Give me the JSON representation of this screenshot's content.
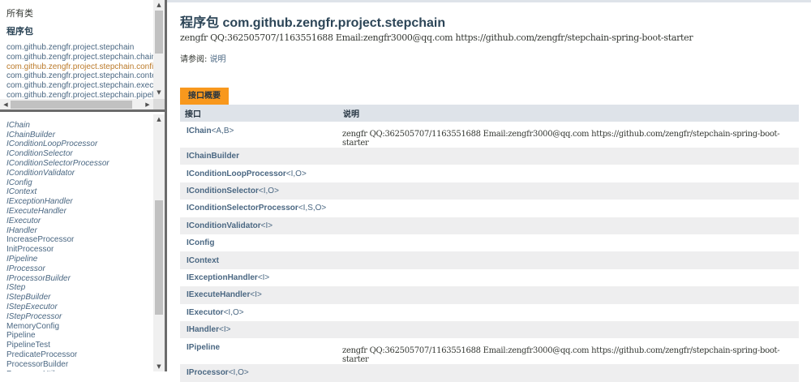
{
  "left": {
    "all_classes": "所有类",
    "packages_heading": "程序包",
    "packages": [
      {
        "label": "com.github.zengfr.project.stepchain",
        "active": false
      },
      {
        "label": "com.github.zengfr.project.stepchain.chain",
        "active": false
      },
      {
        "label": "com.github.zengfr.project.stepchain.config",
        "active": true
      },
      {
        "label": "com.github.zengfr.project.stepchain.context",
        "active": false
      },
      {
        "label": "com.github.zengfr.project.stepchain.executor",
        "active": false
      },
      {
        "label": "com.github.zengfr.project.stepchain.pipeline",
        "active": false
      }
    ],
    "classes": [
      {
        "label": "IChain",
        "interface": true
      },
      {
        "label": "IChainBuilder",
        "interface": true
      },
      {
        "label": "IConditionLoopProcessor",
        "interface": true
      },
      {
        "label": "IConditionSelector",
        "interface": true
      },
      {
        "label": "IConditionSelectorProcessor",
        "interface": true
      },
      {
        "label": "IConditionValidator",
        "interface": true
      },
      {
        "label": "IConfig",
        "interface": true
      },
      {
        "label": "IContext",
        "interface": true
      },
      {
        "label": "IExceptionHandler",
        "interface": true
      },
      {
        "label": "IExecuteHandler",
        "interface": true
      },
      {
        "label": "IExecutor",
        "interface": true
      },
      {
        "label": "IHandler",
        "interface": true
      },
      {
        "label": "IncreaseProcessor",
        "interface": false
      },
      {
        "label": "InitProcessor",
        "interface": false
      },
      {
        "label": "IPipeline",
        "interface": true
      },
      {
        "label": "IProcessor",
        "interface": true
      },
      {
        "label": "IProcessorBuilder",
        "interface": true
      },
      {
        "label": "IStep",
        "interface": true
      },
      {
        "label": "IStepBuilder",
        "interface": true
      },
      {
        "label": "IStepExecutor",
        "interface": true
      },
      {
        "label": "IStepProcessor",
        "interface": true
      },
      {
        "label": "MemoryConfig",
        "interface": false
      },
      {
        "label": "Pipeline",
        "interface": false
      },
      {
        "label": "PipelineTest",
        "interface": false
      },
      {
        "label": "PredicateProcessor",
        "interface": false
      },
      {
        "label": "ProcessorBuilder",
        "interface": false
      },
      {
        "label": "ProcessorUtil",
        "interface": false
      }
    ]
  },
  "main": {
    "title": "程序包 com.github.zengfr.project.stepchain",
    "description": "zengfr QQ:362505707/1163551688 Email:zengfr3000@qq.com https://github.com/zengfr/stepchain-spring-boot-starter",
    "see_also_label": "请参阅:",
    "see_also_link": "说明",
    "tab_label": "接口概要",
    "columns": [
      "接口",
      "说明"
    ],
    "rows": [
      {
        "name": "IChain",
        "generic": "<A,B>",
        "desc": "zengfr QQ:362505707/1163551688 Email:zengfr3000@qq.com https://github.com/zengfr/stepchain-spring-boot-starter"
      },
      {
        "name": "IChainBuilder",
        "generic": "",
        "desc": ""
      },
      {
        "name": "IConditionLoopProcessor",
        "generic": "<I,O>",
        "desc": ""
      },
      {
        "name": "IConditionSelector",
        "generic": "<I,O>",
        "desc": ""
      },
      {
        "name": "IConditionSelectorProcessor",
        "generic": "<I,S,O>",
        "desc": ""
      },
      {
        "name": "IConditionValidator",
        "generic": "<I>",
        "desc": ""
      },
      {
        "name": "IConfig",
        "generic": "",
        "desc": ""
      },
      {
        "name": "IContext",
        "generic": "",
        "desc": ""
      },
      {
        "name": "IExceptionHandler",
        "generic": "<I>",
        "desc": ""
      },
      {
        "name": "IExecuteHandler",
        "generic": "<I>",
        "desc": ""
      },
      {
        "name": "IExecutor",
        "generic": "<I,O>",
        "desc": ""
      },
      {
        "name": "IHandler",
        "generic": "<I>",
        "desc": ""
      },
      {
        "name": "IPipeline",
        "generic": "",
        "desc": "zengfr QQ:362505707/1163551688 Email:zengfr3000@qq.com https://github.com/zengfr/stepchain-spring-boot-starter"
      },
      {
        "name": "IProcessor",
        "generic": "<I,O>",
        "desc": ""
      }
    ]
  }
}
